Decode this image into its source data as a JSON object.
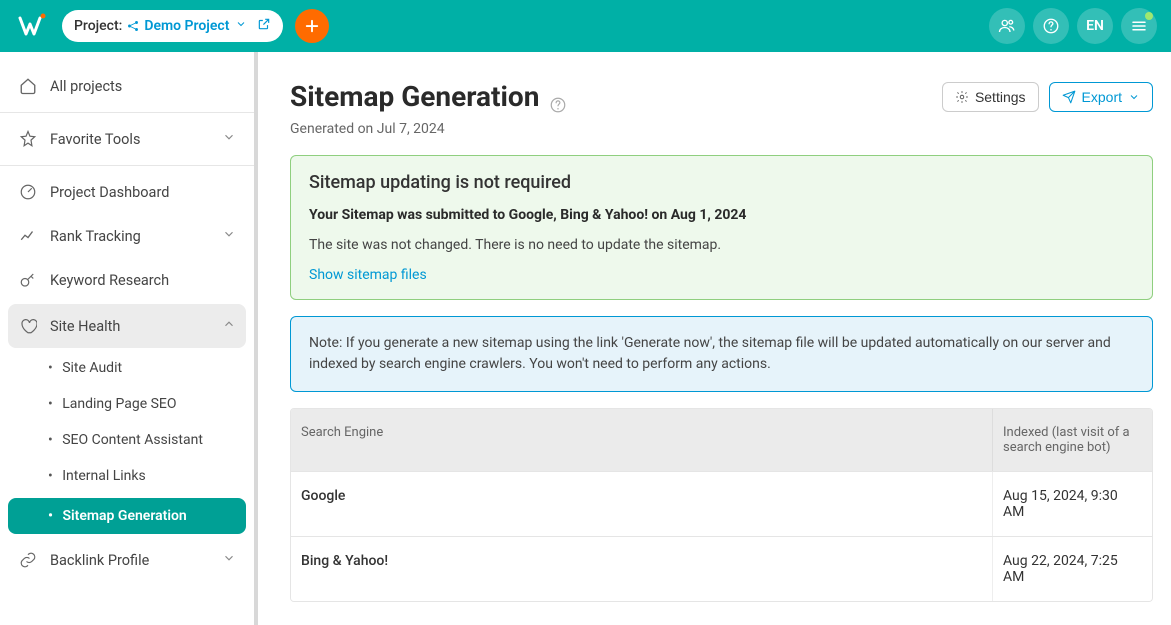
{
  "topbar": {
    "project_label": "Project:",
    "project_name": "Demo Project",
    "lang": "EN"
  },
  "sidebar": {
    "all_projects": "All projects",
    "favorite_tools": "Favorite Tools",
    "project_dashboard": "Project Dashboard",
    "rank_tracking": "Rank Tracking",
    "keyword_research": "Keyword Research",
    "site_health": "Site Health",
    "subs": {
      "site_audit": "Site Audit",
      "landing_page_seo": "Landing Page SEO",
      "seo_content_assistant": "SEO Content Assistant",
      "internal_links": "Internal Links",
      "sitemap_generation": "Sitemap Generation"
    },
    "backlink_profile": "Backlink Profile"
  },
  "page": {
    "title": "Sitemap Generation",
    "settings": "Settings",
    "export": "Export",
    "generated": "Generated on Jul 7, 2024"
  },
  "alert_success": {
    "heading": "Sitemap updating is not required",
    "submitted": "Your Sitemap was submitted to Google, Bing & Yahoo! on Aug 1, 2024",
    "body": "The site was not changed. There is no need to update the sitemap.",
    "link": "Show sitemap files"
  },
  "alert_info": {
    "text": "Note: If you generate a new sitemap using the link 'Generate now', the sitemap file will be updated automatically on our server and indexed by search engine crawlers. You won't need to perform any actions."
  },
  "table": {
    "col_engine": "Search Engine",
    "col_indexed": "Indexed (last visit of a search engine bot)",
    "rows": [
      {
        "engine": "Google",
        "indexed": "Aug 15, 2024, 9:30 AM"
      },
      {
        "engine": "Bing & Yahoo!",
        "indexed": "Aug 22, 2024, 7:25 AM"
      }
    ]
  }
}
